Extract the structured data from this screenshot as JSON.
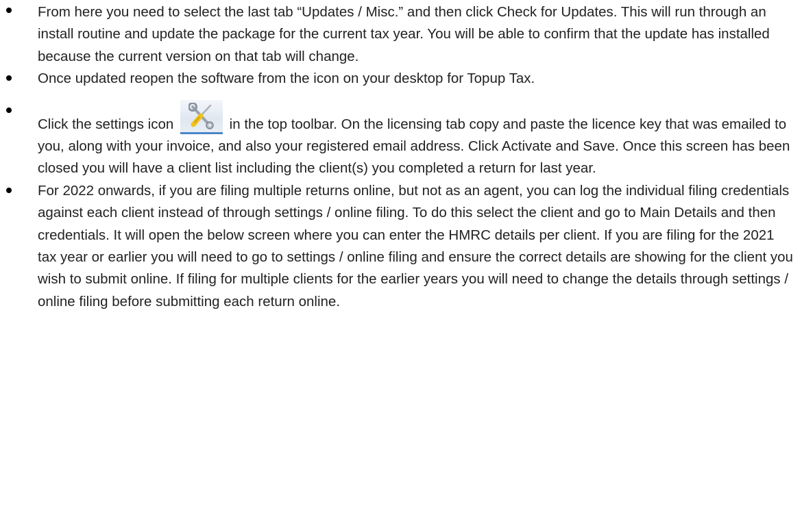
{
  "bullets": [
    {
      "text": "From here you need to select the last tab “Updates / Misc.” and then click Check for Updates. This will run through an install routine and update the package for the current tax year. You will be able to confirm that the update has installed because the current version on that tab will change."
    },
    {
      "text": "Once updated reopen the software from the icon on your desktop for Topup Tax."
    },
    {
      "text_before_icon": "Click the settings icon",
      "icon": "settings-tools-icon",
      "text_after_icon": "in the top toolbar. On the licensing tab copy and paste the licence key that was emailed to you, along with your invoice, and also your registered email address. Click Activate and Save. Once this screen has been closed you will have a client list including the client(s) you completed a return for last year."
    },
    {
      "text": "For 2022 onwards, if you are filing multiple returns online, but not as an agent, you can log the individual filing credentials against each client instead of through settings / online filing. To do this select the client and go to Main Details and then credentials. It will open the below screen where you can enter the HMRC details per client. If you are filing for the 2021 tax year or earlier you will need to go to settings / online filing and ensure the correct details are showing for the client you wish to submit online. If filing for multiple clients for the earlier years you will need to change the details through settings / online filing before submitting each return online."
    }
  ],
  "colors": {
    "text": "#222222",
    "bullet": "#000000",
    "icon_accent": "#4a86c8",
    "screwdriver_handle": "#f2c21b"
  }
}
